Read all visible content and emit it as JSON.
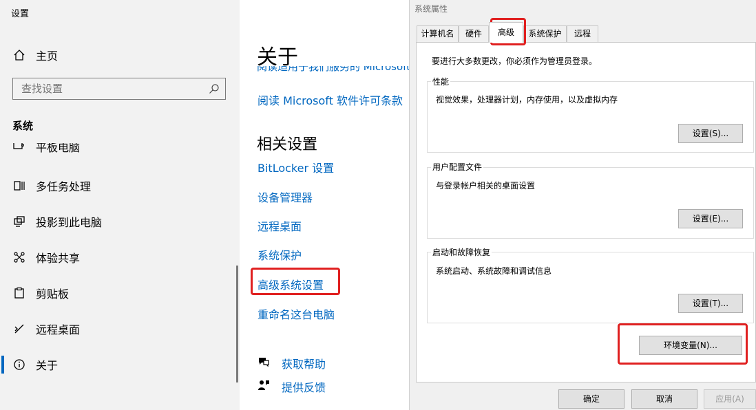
{
  "sidebar": {
    "app_title": "设置",
    "home": {
      "label": "主页",
      "icon": "home-icon"
    },
    "search": {
      "placeholder": "查找设置",
      "icon": "search-icon"
    },
    "section": "系统",
    "cut_item_label": "平板电脑",
    "items": [
      {
        "label": "多任务处理",
        "icon": "multitasking-icon"
      },
      {
        "label": "投影到此电脑",
        "icon": "projecting-icon"
      },
      {
        "label": "体验共享",
        "icon": "shared-experiences-icon"
      },
      {
        "label": "剪贴板",
        "icon": "clipboard-icon"
      },
      {
        "label": "远程桌面",
        "icon": "remote-desktop-icon"
      },
      {
        "label": "关于",
        "icon": "info-icon",
        "active": true
      }
    ]
  },
  "about": {
    "title": "关于",
    "cut_link": "阅读适用于我们服务的 Microsoft",
    "license_link": "阅读 Microsoft 软件许可条款",
    "related_title": "相关设置",
    "related_links": [
      "BitLocker 设置",
      "设备管理器",
      "远程桌面",
      "系统保护",
      "高级系统设置",
      "重命名这台电脑"
    ],
    "help": "获取帮助",
    "feedback": "提供反馈"
  },
  "dialog": {
    "title": "系统属性",
    "tabs": [
      "计算机名",
      "硬件",
      "高级",
      "系统保护",
      "远程"
    ],
    "active_tab": "高级",
    "admin_note": "要进行大多数更改，你必须作为管理员登录。",
    "groups": [
      {
        "title": "性能",
        "desc": "视觉效果，处理器计划，内存使用，以及虚拟内存",
        "button": "设置(S)..."
      },
      {
        "title": "用户配置文件",
        "desc": "与登录帐户相关的桌面设置",
        "button": "设置(E)..."
      },
      {
        "title": "启动和故障恢复",
        "desc": "系统启动、系统故障和调试信息",
        "button": "设置(T)..."
      }
    ],
    "env_button": "环境变量(N)...",
    "ok": "确定",
    "cancel": "取消",
    "apply": "应用(A)"
  },
  "colors": {
    "link": "#0067c0",
    "highlight": "#e02020",
    "sidebar_bg": "#f2f2f2",
    "dialog_bg": "#f0f0f0"
  }
}
